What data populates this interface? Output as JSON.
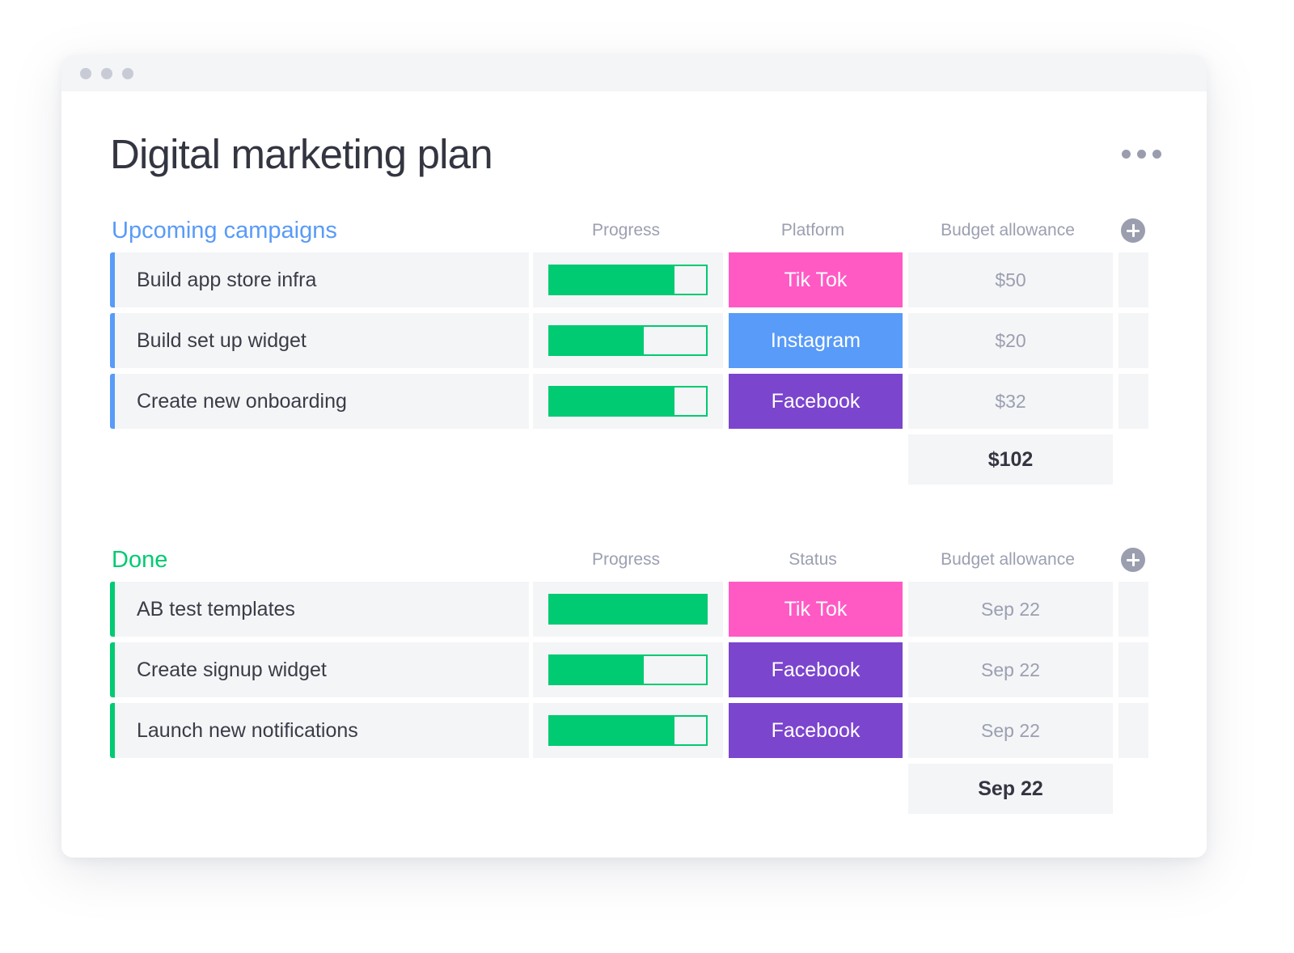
{
  "window": {
    "dots": [
      "dot-red",
      "dot-yellow",
      "dot-green"
    ]
  },
  "header": {
    "title": "Digital marketing plan",
    "more_menu_label": "•••"
  },
  "colors": {
    "accent_blue": "#589bf8",
    "accent_green": "#00ca72",
    "tiktok_pink": "#ff5ac4",
    "instagram_blue": "#589bf8",
    "facebook_purple": "#7b45ce",
    "cell_bg": "#f4f5f7",
    "muted_text": "#9b9fb0",
    "title_text": "#333541"
  },
  "groups": [
    {
      "id": "upcoming",
      "title": "Upcoming campaigns",
      "accent": "blue",
      "columns": {
        "progress": "Progress",
        "middle": "Platform",
        "budget": "Budget allowance",
        "add": "+"
      },
      "rows": [
        {
          "name": "Build app store infra",
          "progress": 80,
          "chip": {
            "label": "Tik Tok",
            "color": "#ff5ac4"
          },
          "budget": "$50"
        },
        {
          "name": "Build set up widget",
          "progress": 60,
          "chip": {
            "label": "Instagram",
            "color": "#589bf8"
          },
          "budget": "$20"
        },
        {
          "name": "Create new onboarding",
          "progress": 80,
          "chip": {
            "label": "Facebook",
            "color": "#7b45ce"
          },
          "budget": "$32"
        }
      ],
      "summary": {
        "budget": "$102"
      }
    },
    {
      "id": "done",
      "title": "Done",
      "accent": "green",
      "columns": {
        "progress": "Progress",
        "middle": "Status",
        "budget": "Budget allowance",
        "add": "+"
      },
      "rows": [
        {
          "name": "AB test templates",
          "progress": 100,
          "chip": {
            "label": "Tik Tok",
            "color": "#ff5ac4"
          },
          "budget": "Sep 22"
        },
        {
          "name": "Create signup widget",
          "progress": 60,
          "chip": {
            "label": "Facebook",
            "color": "#7b45ce"
          },
          "budget": "Sep 22"
        },
        {
          "name": "Launch new notifications",
          "progress": 80,
          "chip": {
            "label": "Facebook",
            "color": "#7b45ce"
          },
          "budget": "Sep 22"
        }
      ],
      "summary": {
        "budget": "Sep 22"
      }
    }
  ]
}
